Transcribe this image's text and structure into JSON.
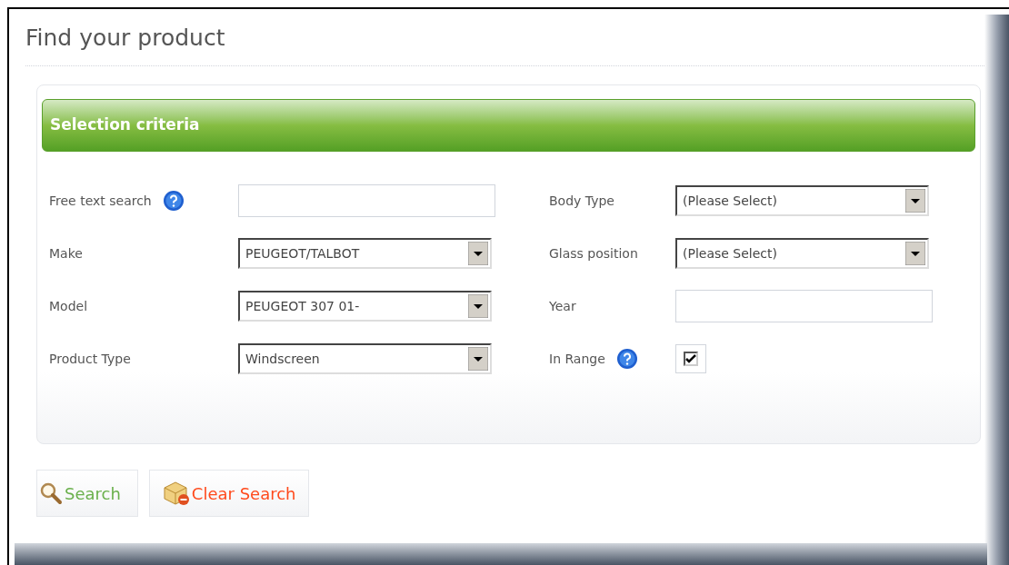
{
  "page": {
    "title": "Find your product"
  },
  "panel": {
    "heading": "Selection criteria"
  },
  "columns": [
    {
      "fields": [
        {
          "label": "Free text search",
          "help": true,
          "kind": "text"
        },
        {
          "label": "Make",
          "help": false,
          "kind": "select",
          "value": "PEUGEOT/TALBOT"
        },
        {
          "label": "Model",
          "help": false,
          "kind": "select",
          "value": "PEUGEOT 307 01-"
        },
        {
          "label": "Product Type",
          "help": false,
          "kind": "select",
          "value": "Windscreen"
        }
      ]
    },
    {
      "fields": [
        {
          "label": "Body Type",
          "help": false,
          "kind": "select",
          "value": "(Please Select)"
        },
        {
          "label": "Glass position",
          "help": false,
          "kind": "select",
          "value": "(Please Select)"
        },
        {
          "label": "Year",
          "help": false,
          "kind": "text"
        },
        {
          "label": "In Range",
          "help": true,
          "kind": "checkbox",
          "checked": true
        }
      ]
    }
  ],
  "buttons": [
    {
      "label": "Search",
      "kind": "search"
    },
    {
      "label": "Clear Search",
      "kind": "clear"
    }
  ]
}
